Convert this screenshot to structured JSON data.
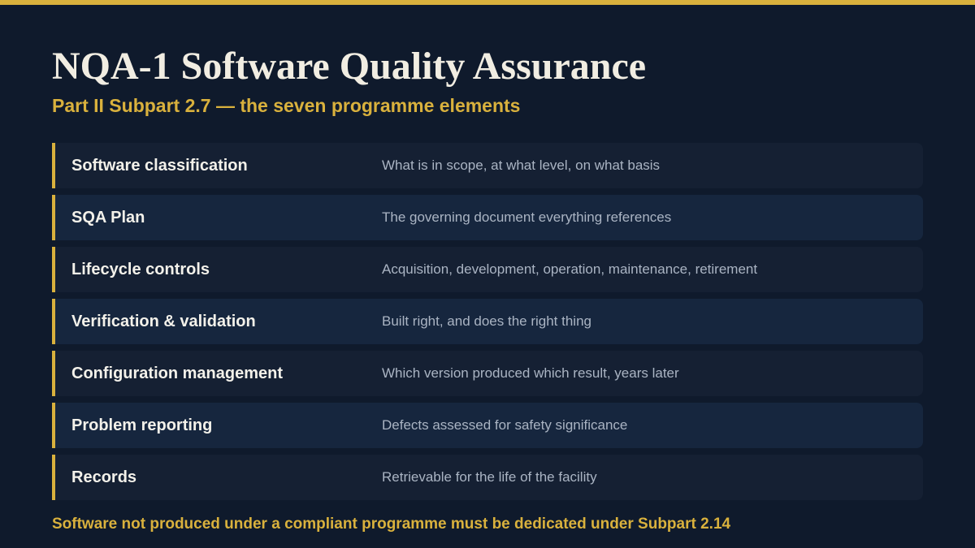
{
  "colors": {
    "background": "#0f1a2c",
    "accent": "#d9b13d",
    "title_text": "#f1ede2",
    "row_odd": "#152033",
    "row_even": "#16263e",
    "description_text": "#aab4c3"
  },
  "slide": {
    "title": "NQA-1 Software Quality Assurance",
    "subtitle": "Part II Subpart 2.7 — the seven programme elements",
    "elements": [
      {
        "label": "Software classification",
        "description": "What is in scope, at what level, on what basis"
      },
      {
        "label": "SQA Plan",
        "description": "The governing document everything references"
      },
      {
        "label": "Lifecycle controls",
        "description": "Acquisition, development, operation, maintenance, retirement"
      },
      {
        "label": "Verification & validation",
        "description": "Built right, and does the right thing"
      },
      {
        "label": "Configuration management",
        "description": "Which version produced which result, years later"
      },
      {
        "label": "Problem reporting",
        "description": "Defects assessed for safety significance"
      },
      {
        "label": "Records",
        "description": "Retrievable for the life of the facility"
      }
    ],
    "footer": "Software not produced under a compliant programme must be dedicated under Subpart 2.14"
  }
}
